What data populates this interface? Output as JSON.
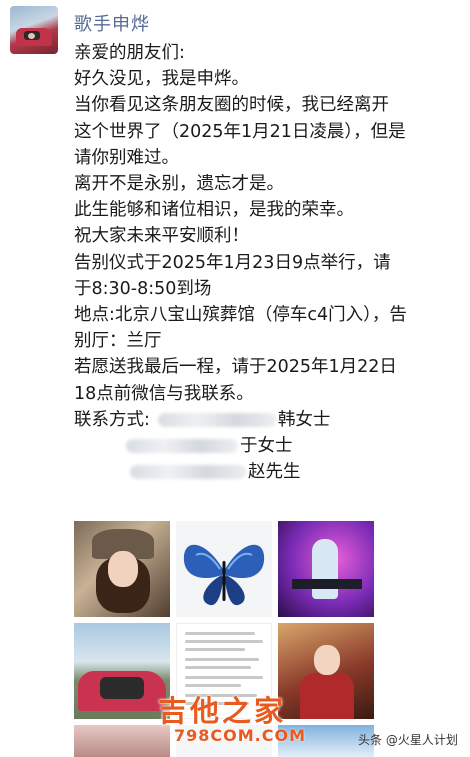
{
  "author": {
    "name": "歌手申烨"
  },
  "post": {
    "lines": [
      "亲爱的朋友们:",
      "好久没见，我是申烨。",
      "当你看见这条朋友圈的时候，我已经离开",
      "这个世界了（2025年1月21日凌晨），但是",
      "请你别难过。",
      "离开不是永别，遗忘才是。",
      "此生能够和诸位相识，是我的荣幸。",
      "祝大家未来平安顺利！",
      "告别仪式于2025年1月23日9点举行，请",
      "于8:30-8:50到场",
      "地点:北京八宝山殡葬馆（停车c4门入），告",
      "别厅：兰厅",
      "若愿送我最后一程，请于2025年1月22日",
      "18点前微信与我联系。"
    ],
    "contact_label": "联系方式:",
    "contacts": [
      "韩女士",
      "于女士",
      "赵先生"
    ]
  },
  "watermark": {
    "main": "吉他之家",
    "sub": "798COM.COM"
  },
  "source": "头条 @火星人计划"
}
